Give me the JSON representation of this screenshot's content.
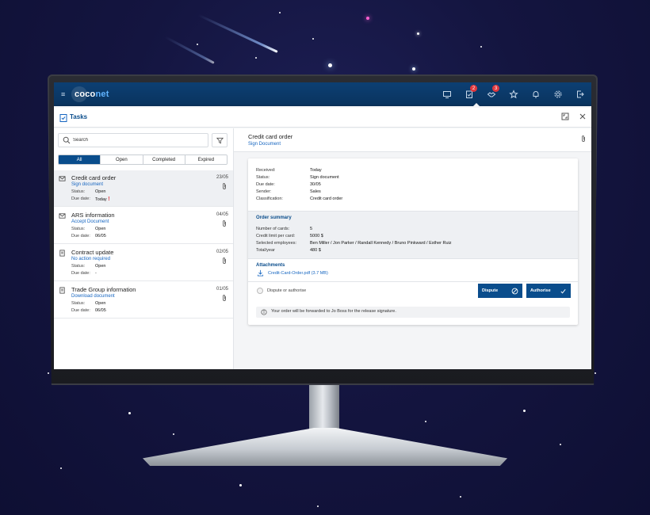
{
  "app": {
    "logo_coco": "coco",
    "logo_net": "net",
    "page_title": "Tasks",
    "menu_glyph": "≡",
    "nav_icons": [
      {
        "name": "monitor-icon",
        "badge": ""
      },
      {
        "name": "tasks-icon",
        "badge": "2"
      },
      {
        "name": "handshake-icon",
        "badge": "3"
      },
      {
        "name": "star-icon",
        "badge": ""
      },
      {
        "name": "notification-icon",
        "badge": ""
      },
      {
        "name": "gear-icon",
        "badge": ""
      },
      {
        "name": "logout-icon",
        "badge": ""
      }
    ],
    "colors": {
      "header": "#0c3f73",
      "accent": "#0a4d8c",
      "link": "#1565c0",
      "alert": "#e0383e"
    }
  },
  "list": {
    "search_placeholder": "Search",
    "tabs": [
      "All",
      "Open",
      "Completed",
      "Expired"
    ],
    "active_tab": "All",
    "status_label": "Status:",
    "due_label": "Due date:",
    "tasks": [
      {
        "title": "Credit card order",
        "action": "Sign document",
        "date": "23/05",
        "status": "Open",
        "due": "Today",
        "icon": "envelope-icon"
      },
      {
        "title": "ARS information",
        "action": "Accept Document",
        "date": "04/05",
        "status": "Open",
        "due": "06/05",
        "icon": "envelope-icon"
      },
      {
        "title": "Contract update",
        "action": "No action required",
        "date": "02/05",
        "status": "Open",
        "due": "-",
        "icon": "document-icon"
      },
      {
        "title": "Trade Group information",
        "action": "Download document",
        "date": "01/05",
        "status": "Open",
        "due": "06/05",
        "icon": "document-icon"
      }
    ]
  },
  "detail": {
    "title": "Credit card order",
    "subtitle": "Sign Document",
    "meta": [
      {
        "k": "Received:",
        "v": "Today"
      },
      {
        "k": "Status:",
        "v": "Sign document"
      },
      {
        "k": "Due date:",
        "v": "30/05"
      },
      {
        "k": "Sender:",
        "v": "Sales"
      },
      {
        "k": "Classification:",
        "v": "Credit card order"
      }
    ],
    "summary_title": "Order summary",
    "summary": [
      {
        "k": "Number of cards:",
        "v": "5"
      },
      {
        "k": "Credit limit per card:",
        "v": "5000 $"
      },
      {
        "k": "Selected employees:",
        "v": "Ben Miller / Jon Parker / Randall Kennedy / Bruno Pinkward / Esther Ruiz"
      },
      {
        "k": "Total/year",
        "v": "480 $"
      }
    ],
    "attachments_title": "Attachments",
    "attachment": "Credit-Card-Order.pdf (3.7 MB)",
    "option_label": "Dispute or authorise",
    "dispute_label": "Dispute",
    "authorise_label": "Authorise",
    "info": "Your order will be forwarded to Jo Boss for the release signature."
  }
}
